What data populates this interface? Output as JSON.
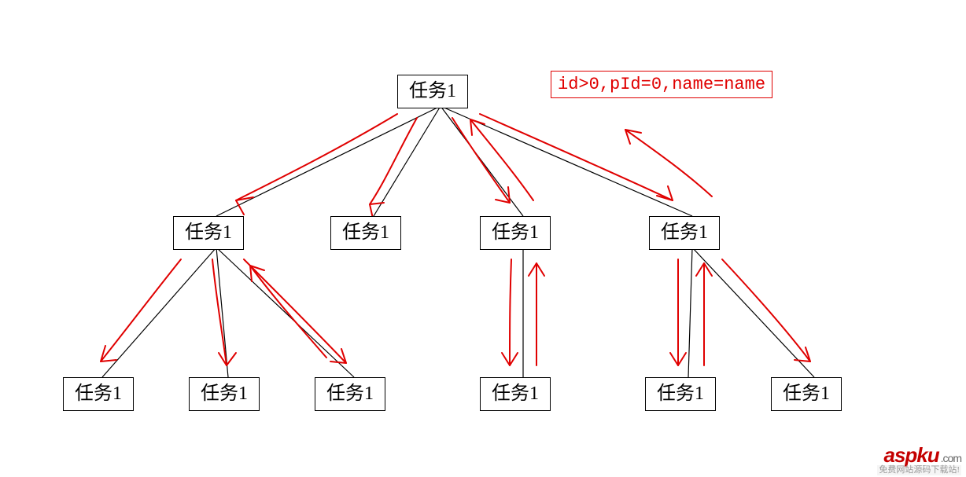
{
  "annotation": {
    "text": "id>0,pId=0,name=name"
  },
  "nodes": {
    "root": {
      "label": "任务1"
    },
    "l2a": {
      "label": "任务1"
    },
    "l2b": {
      "label": "任务1"
    },
    "l2c": {
      "label": "任务1"
    },
    "l2d": {
      "label": "任务1"
    },
    "l3a": {
      "label": "任务1"
    },
    "l3b": {
      "label": "任务1"
    },
    "l3c": {
      "label": "任务1"
    },
    "l3d": {
      "label": "任务1"
    },
    "l3e": {
      "label": "任务1"
    },
    "l3f": {
      "label": "任务1"
    }
  },
  "tree": {
    "root_children": [
      "l2a",
      "l2b",
      "l2c",
      "l2d"
    ],
    "l2a_children": [
      "l3a",
      "l3b",
      "l3c"
    ],
    "l2b_children": [],
    "l2c_children": [
      "l3d"
    ],
    "l2d_children": [
      "l3e",
      "l3f"
    ]
  },
  "watermark": {
    "brand": "aspku",
    "suffix": ".com",
    "tagline": "免费网站源码下载站!"
  },
  "colors": {
    "arrow": "#e00000",
    "line": "#000000"
  }
}
